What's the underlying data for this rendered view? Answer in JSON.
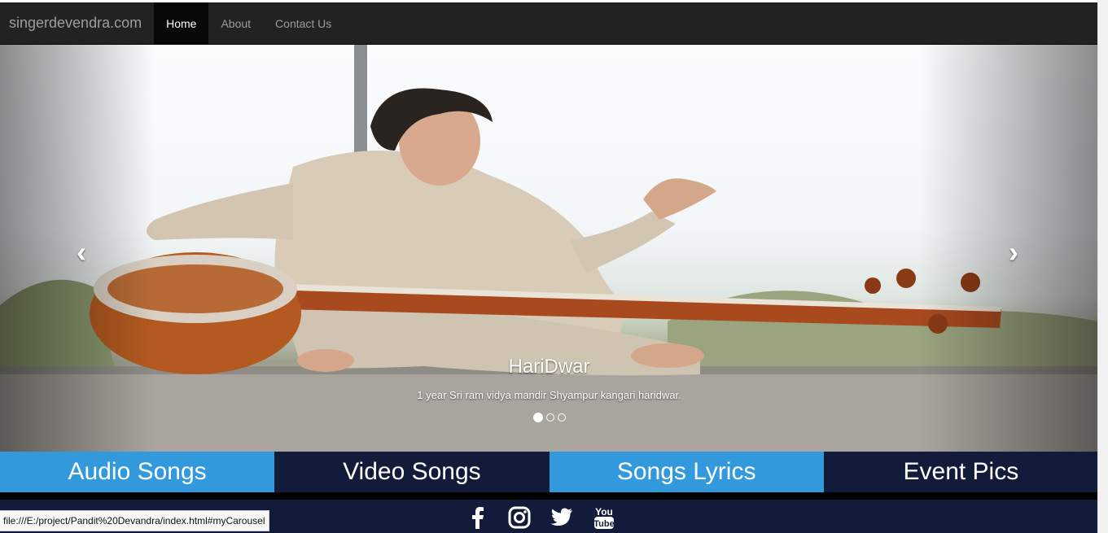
{
  "navbar": {
    "brand": "singerdevendra.com",
    "items": [
      {
        "label": "Home",
        "active": true
      },
      {
        "label": "About",
        "active": false
      },
      {
        "label": "Contact Us",
        "active": false
      }
    ]
  },
  "carousel": {
    "prev_icon": "chevron-left-icon",
    "next_icon": "chevron-right-icon",
    "caption_title": "HariDwar",
    "caption_text": "1 year Sri ram vidya mandir Shyampur kangari haridwar.",
    "indicator_count": 3,
    "active_indicator": 0
  },
  "categories": [
    {
      "label": "Audio Songs",
      "color": "#3399dd"
    },
    {
      "label": "Video Songs",
      "color": "#131b3a"
    },
    {
      "label": "Songs Lyrics",
      "color": "#3399dd"
    },
    {
      "label": "Event Pics",
      "color": "#131b3a"
    }
  ],
  "social": [
    "facebook-icon",
    "instagram-icon",
    "twitter-icon",
    "youtube-icon"
  ],
  "social_text": {
    "youtube": "You\nTube"
  },
  "status_url": "file:///E:/project/Pandit%20Devandra/index.html#myCarousel",
  "colors": {
    "navbar": "#222222",
    "accent_blue": "#3399dd",
    "navy": "#131b3a"
  }
}
